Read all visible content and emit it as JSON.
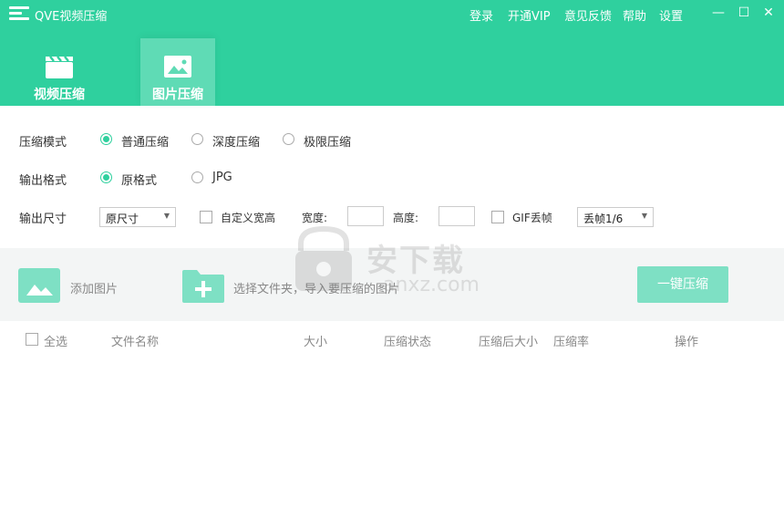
{
  "app": {
    "title": "QVE视频压缩"
  },
  "top_menu": {
    "login": "登录",
    "vip": "开通VIP",
    "feedback": "意见反馈",
    "help": "帮助",
    "settings": "设置"
  },
  "window_controls": {
    "minimize": "—",
    "maximize": "☐",
    "close": "✕"
  },
  "tabs": [
    {
      "label": "视频压缩",
      "icon": "clapperboard-icon",
      "active": false
    },
    {
      "label": "图片压缩",
      "icon": "image-icon",
      "active": true
    }
  ],
  "settings": {
    "mode": {
      "label": "压缩模式",
      "options": [
        "普通压缩",
        "深度压缩",
        "极限压缩"
      ],
      "selected": "普通压缩"
    },
    "format": {
      "label": "输出格式",
      "options": [
        "原格式",
        "JPG"
      ],
      "selected": "原格式"
    },
    "size": {
      "label": "输出尺寸",
      "select_value": "原尺寸",
      "custom_label": "自定义宽高",
      "width_label": "宽度:",
      "height_label": "高度:",
      "gif_label": "GIF丢帧",
      "gif_select_value": "丢帧1/6"
    }
  },
  "actions": {
    "add_image": "添加图片",
    "choose_folder": "选择文件夹，导入要压缩的图片",
    "compress_all": "一键压缩"
  },
  "table": {
    "select_all": "全选",
    "columns": [
      "文件名称",
      "大小",
      "压缩状态",
      "压缩后大小",
      "压缩率",
      "操作"
    ]
  },
  "watermark": {
    "text": "安下载",
    "sub": "anxz.com"
  },
  "colors": {
    "accent": "#2fd09e",
    "accent_light": "#7ee0c4",
    "tab_active": "#5fdbb5"
  }
}
